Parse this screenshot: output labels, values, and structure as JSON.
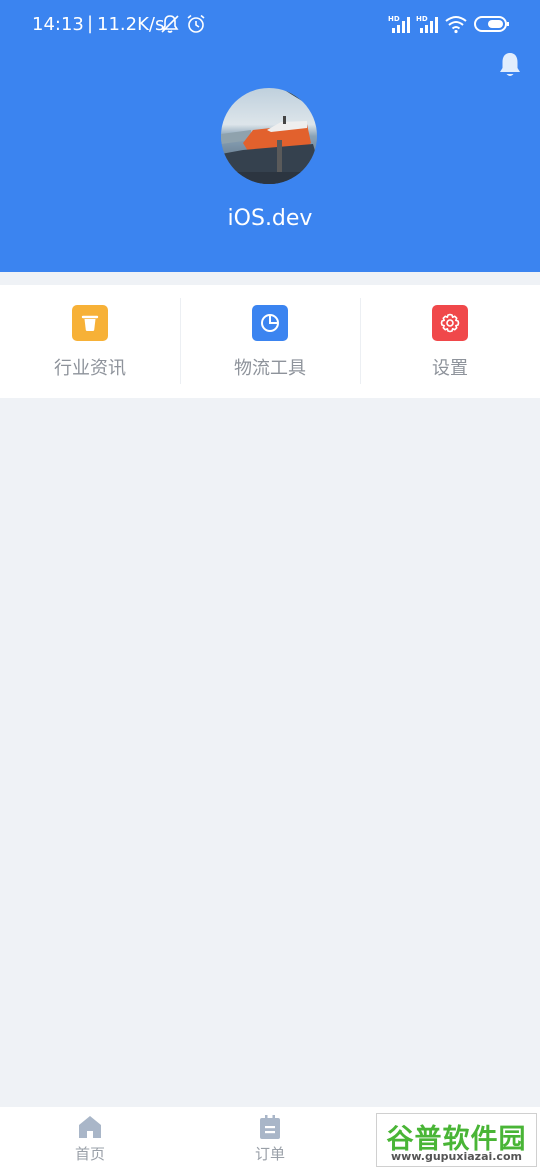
{
  "status_bar": {
    "time": "14:13",
    "separator": "|",
    "net_speed": "11.2K/s",
    "icons": [
      "mute-icon",
      "alarm-icon",
      "hd-signal-icon",
      "hd-signal-icon",
      "wifi-icon",
      "battery-icon"
    ],
    "hd_label": "HD"
  },
  "header": {
    "username": "iOS.dev",
    "bell_icon": "bell-icon",
    "background_color": "#3b84f0"
  },
  "menu": {
    "items": [
      {
        "label": "行业资讯",
        "icon": "trash-bin-icon",
        "color": "#f7b137"
      },
      {
        "label": "物流工具",
        "icon": "pie-chart-icon",
        "color": "#3b84f0"
      },
      {
        "label": "设置",
        "icon": "gear-icon",
        "color": "#f0484a"
      }
    ]
  },
  "tabbar": {
    "items": [
      {
        "label": "首页",
        "icon": "home-icon"
      },
      {
        "label": "订单",
        "icon": "order-icon"
      },
      {
        "label": "",
        "icon": "profile-icon"
      }
    ]
  },
  "watermark": {
    "text": "谷普软件园",
    "url": "www.gupuxiazai.com"
  }
}
